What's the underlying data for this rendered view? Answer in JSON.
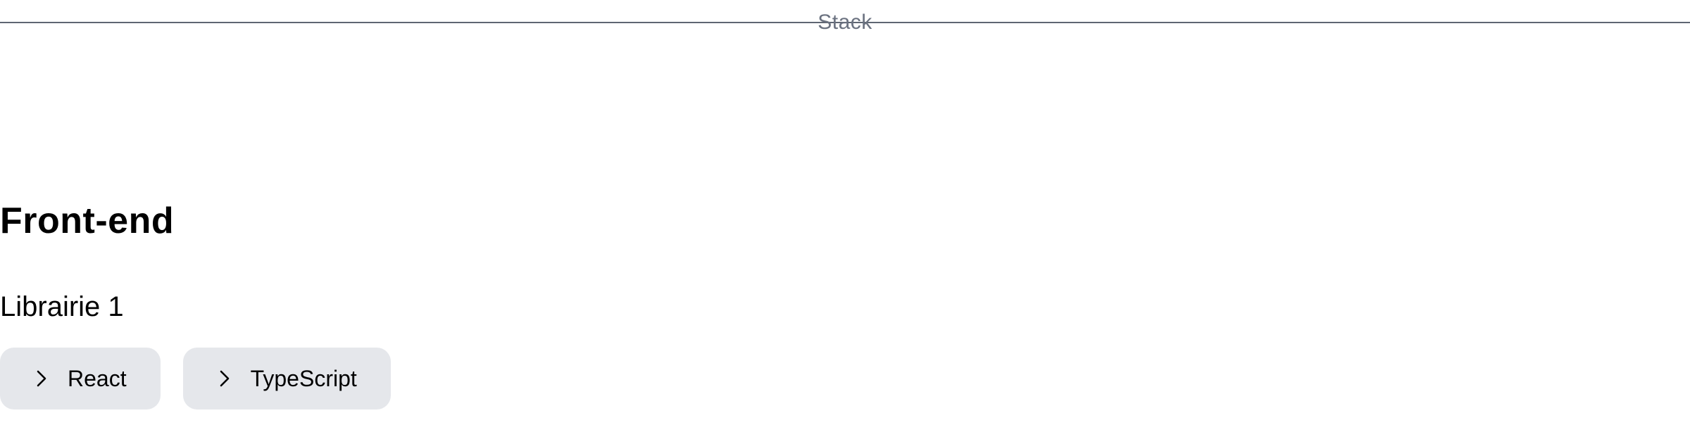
{
  "divider": {
    "label": "Stack"
  },
  "section": {
    "title": "Front-end",
    "group_label": "Librairie 1",
    "chips": [
      {
        "label": "React",
        "icon": "chevron-right-icon"
      },
      {
        "label": "TypeScript",
        "icon": "chevron-right-icon"
      }
    ]
  },
  "colors": {
    "divider_line": "#5f6672",
    "divider_text": "#6b7280",
    "chip_background": "#e5e7eb",
    "text": "#000000"
  }
}
